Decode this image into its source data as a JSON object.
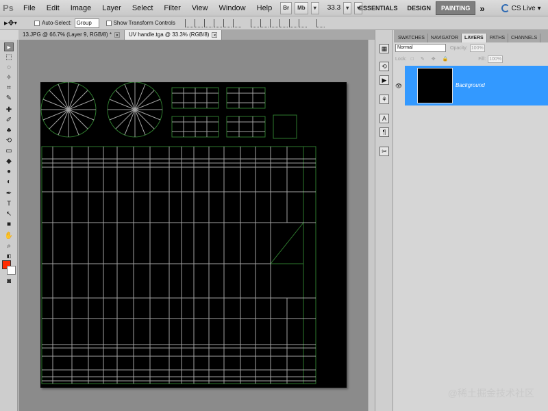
{
  "app": {
    "logo": "Ps"
  },
  "menu": [
    "File",
    "Edit",
    "Image",
    "Layer",
    "Select",
    "Filter",
    "View",
    "Window",
    "Help"
  ],
  "menubar_buttons": {
    "bridge": "Br",
    "mini_bridge": "Mb",
    "zoom": "33.3"
  },
  "workspaces": [
    "ESSENTIALS",
    "DESIGN",
    "PAINTING"
  ],
  "workspace_active": "PAINTING",
  "more": "»",
  "cs_live": "CS Live",
  "options": {
    "auto_select_label": "Auto-Select:",
    "auto_select_value": "Group",
    "transform_label": "Show Transform Controls"
  },
  "tabs": [
    {
      "label": "13.JPG @ 66.7% (Layer 9, RGB/8) *"
    },
    {
      "label": "UV handle.tga @ 33.3% (RGB/8)"
    }
  ],
  "panel": {
    "tabs": [
      "SWATCHES",
      "NAVIGATOR",
      "LAYERS",
      "PATHS",
      "CHANNELS"
    ],
    "active_tab": "LAYERS",
    "blend_mode": "Normal",
    "opacity_label": "Opacity:",
    "opacity_value": "100%",
    "lock_label": "Lock:",
    "fill_label": "Fill:",
    "fill_value": "100%",
    "layer_name": "Background"
  },
  "colors": {
    "foreground": "#ff2a00",
    "background": "#ffffff",
    "selection": "#3399ff",
    "uv_wire": "#2e7a2e",
    "uv_wire_light": "#bfbfbf"
  },
  "watermark": "@稀土掘金技术社区"
}
